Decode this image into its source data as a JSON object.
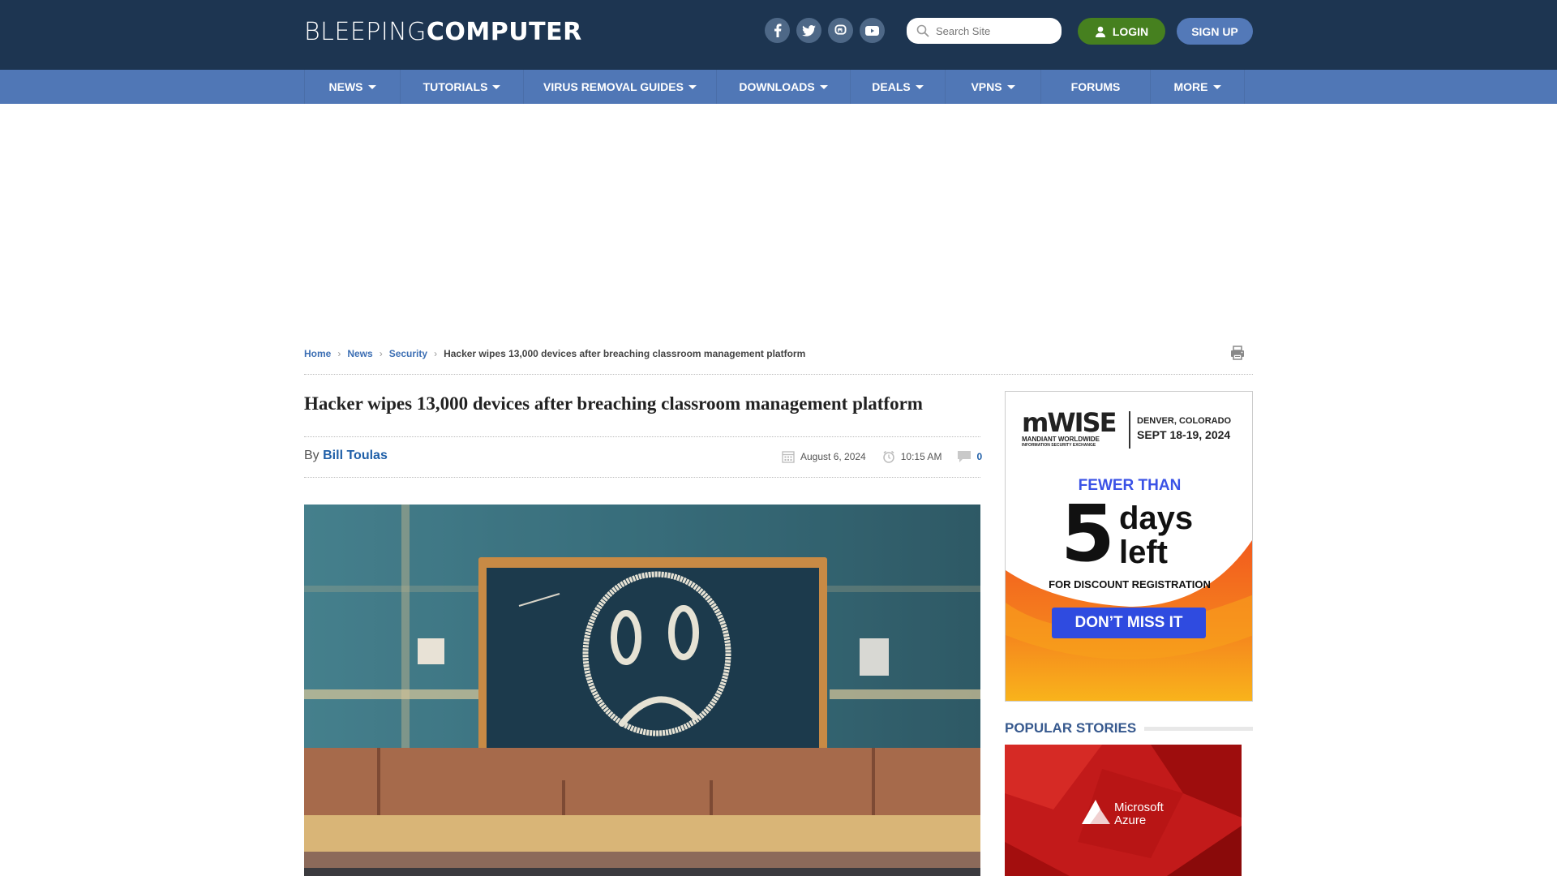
{
  "header": {
    "logo_light": "BLEEPING",
    "logo_bold": "COMPUTER",
    "social": [
      {
        "name": "facebook",
        "glyph": "f"
      },
      {
        "name": "twitter",
        "glyph": "t"
      },
      {
        "name": "mastodon",
        "glyph": "m"
      },
      {
        "name": "youtube",
        "glyph": "▶"
      }
    ],
    "search_placeholder": "Search Site",
    "login_label": "LOGIN",
    "signup_label": "SIGN UP"
  },
  "nav": {
    "items": [
      {
        "label": "NEWS",
        "dropdown": true
      },
      {
        "label": "TUTORIALS",
        "dropdown": true
      },
      {
        "label": "VIRUS REMOVAL GUIDES",
        "dropdown": true
      },
      {
        "label": "DOWNLOADS",
        "dropdown": true
      },
      {
        "label": "DEALS",
        "dropdown": true
      },
      {
        "label": "VPNS",
        "dropdown": true
      },
      {
        "label": "FORUMS",
        "dropdown": false
      },
      {
        "label": "MORE",
        "dropdown": true
      }
    ]
  },
  "breadcrumb": {
    "items": [
      "Home",
      "News",
      "Security"
    ],
    "current": "Hacker wipes 13,000 devices after breaching classroom management platform"
  },
  "article": {
    "title": "Hacker wipes 13,000 devices after breaching classroom management platform",
    "by_label": "By",
    "author": "Bill Toulas",
    "date": "August 6, 2024",
    "time": "10:15 AM",
    "comments": "0",
    "image_alt": "Chalkboard with sad face drawn in chalk"
  },
  "ad": {
    "brand": "mWISE",
    "brand_sub1": "MANDIANT WORLDWIDE",
    "brand_sub2": "INFORMATION SECURITY EXCHANGE",
    "location": "DENVER, COLORADO",
    "dates": "SEPT 18-19, 2024",
    "fewer_than": "FEWER THAN",
    "big_number": "5",
    "days": "days",
    "left": "left",
    "subtitle": "FOR DISCOUNT REGISTRATION",
    "cta": "DON’T MISS IT"
  },
  "sidebar": {
    "popular_title": "POPULAR STORIES",
    "story_image_text1": "Microsoft",
    "story_image_text2": "Azure"
  },
  "colors": {
    "header_bg": "#1d3551",
    "nav_bg": "#5077b6",
    "login_green": "#46801f",
    "signup_blue": "#5379b8",
    "link_blue": "#1f5fa8"
  }
}
